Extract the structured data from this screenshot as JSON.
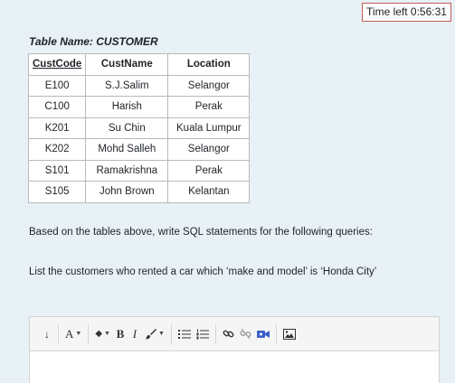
{
  "timer": {
    "text": "Time left 0:56:31"
  },
  "table": {
    "title": "Table Name: CUSTOMER",
    "headers": [
      "CustCode",
      "CustName",
      "Location"
    ],
    "rows": [
      [
        "E100",
        "S.J.Salim",
        "Selangor"
      ],
      [
        "C100",
        "Harish",
        "Perak"
      ],
      [
        "K201",
        "Su Chin",
        "Kuala Lumpur"
      ],
      [
        "K202",
        "Mohd Salleh",
        "Selangor"
      ],
      [
        "S101",
        "Ramakrishna",
        "Perak"
      ],
      [
        "S105",
        "John Brown",
        "Kelantan"
      ]
    ]
  },
  "question": {
    "text": "Based on the tables above, write SQL statements for the following queries:"
  },
  "query": {
    "text": "List the customers who rented a car which ‘make and model’ is ‘Honda City’"
  },
  "toolbar": {
    "expand_glyph": "↓",
    "font_glyph": "A",
    "color_glyph": "◆",
    "bold_glyph": "B",
    "italic_glyph": "I",
    "caret_glyph": "▼"
  },
  "colors": {
    "background": "#e8f1f5",
    "timer_border": "#c45a5a",
    "table_border": "#b9b9b9",
    "recordrtc_icon": "#3a5fc8"
  }
}
